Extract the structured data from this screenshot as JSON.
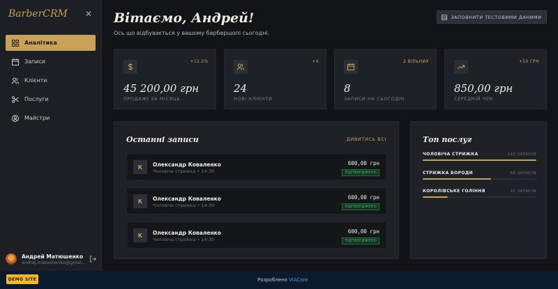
{
  "sidebar": {
    "logo": "BarberCRM",
    "close_icon": "close-icon",
    "items": [
      {
        "label": "Аналітика",
        "icon": "dashboard-icon",
        "active": true
      },
      {
        "label": "Записи",
        "icon": "calendar-icon",
        "active": false
      },
      {
        "label": "Клієнти",
        "icon": "users-icon",
        "active": false
      },
      {
        "label": "Послуги",
        "icon": "scissors-icon",
        "active": false
      },
      {
        "label": "Майстри",
        "icon": "user-circle-icon",
        "active": false
      }
    ],
    "user": {
      "name": "Андрей Матюшенко",
      "email": "andrej.matushenko@gmail.com"
    }
  },
  "header": {
    "greeting": "Вітаємо, Андрей!",
    "subtitle": "Ось що відбувається у вашому барбершопі сьогодні.",
    "fill_button": "ЗАПОВНИТИ ТЕСТОВИМИ ДАНИМИ"
  },
  "stats": [
    {
      "icon": "dollar-icon",
      "badge": "+12.5%",
      "value": "45 200,00 грн",
      "label": "ПРОДАЖІ ЗА МІСЯЦЬ"
    },
    {
      "icon": "users-icon",
      "badge": "+4",
      "value": "24",
      "label": "НОВІ КЛІЄНТИ"
    },
    {
      "icon": "calendar-icon",
      "badge": "2 ВІЛЬНИХ",
      "value": "8",
      "label": "ЗАПИСИ НА СЬОГОДНІ"
    },
    {
      "icon": "trend-up-icon",
      "badge": "+50 ГРН",
      "value": "850,00 грн",
      "label": "СЕРЕДНІЙ ЧЕК"
    }
  ],
  "recent": {
    "title": "Останні записи",
    "view_all": "ДИВИТИСЬ ВСІ",
    "items": [
      {
        "initial": "К",
        "name": "Олександр Коваленко",
        "service": "Чоловіча стрижка • 14:30",
        "price": "600,00 грн",
        "status": "ПІДТВЕРДЖЕНО"
      },
      {
        "initial": "К",
        "name": "Олександр Коваленко",
        "service": "Чоловіча стрижка • 14:30",
        "price": "600,00 грн",
        "status": "ПІДТВЕРДЖЕНО"
      },
      {
        "initial": "К",
        "name": "Олександр Коваленко",
        "service": "Чоловіча стрижка • 14:30",
        "price": "600,00 грн",
        "status": "ПІДТВЕРДЖЕНО"
      }
    ]
  },
  "top_services": {
    "title": "Топ послуг",
    "items": [
      {
        "name": "ЧОЛОВІЧА СТРИЖКА",
        "count": "142 ЗАПИСІВ",
        "share": 1.0
      },
      {
        "name": "СТРИЖКА БОРОДИ",
        "count": "68 ЗАПИСІВ",
        "share": 0.6
      },
      {
        "name": "КОРОЛІВСЬКЕ ГОЛІННЯ",
        "count": "32 ЗАПИСІВ",
        "share": 0.22
      }
    ]
  },
  "footer": {
    "demo_badge": "DEMO SITE",
    "powered_prefix": "Розроблено",
    "powered_link": "ViACore"
  },
  "colors": {
    "accent": "#c9a25a",
    "success": "#3ec06a",
    "footer_link": "#4f9fe0"
  }
}
